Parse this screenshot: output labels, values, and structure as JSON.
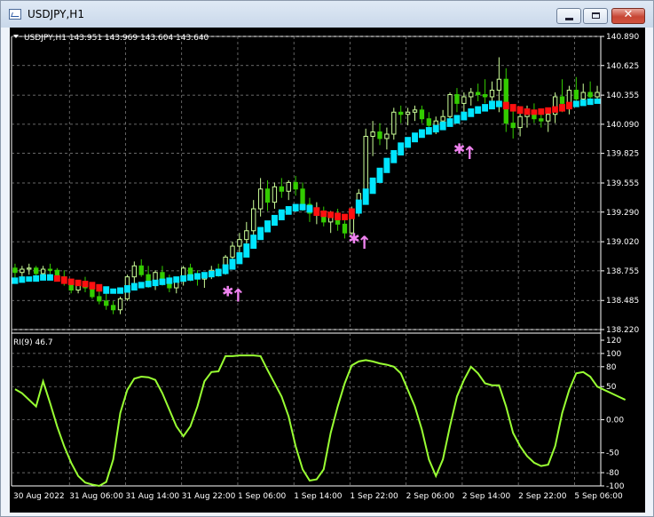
{
  "window": {
    "title": "USDJPY,H1"
  },
  "price_panel": {
    "header": "USDJPY,H1  143.951 143.969 143.604 143.640",
    "ticks": [
      "140.890",
      "140.625",
      "140.355",
      "140.090",
      "139.825",
      "139.555",
      "139.290",
      "139.020",
      "138.755",
      "138.485",
      "138.220"
    ]
  },
  "indicator_panel": {
    "header": "RI(9) 46.7",
    "ticks": [
      "120",
      "100",
      "80",
      "50",
      "0.00",
      "-50",
      "-80",
      "-100"
    ]
  },
  "time_axis": [
    "30 Aug 2022",
    "31 Aug 06:00",
    "31 Aug 14:00",
    "31 Aug 22:00",
    "1 Sep 06:00",
    "1 Sep 14:00",
    "1 Sep 22:00",
    "2 Sep 06:00",
    "2 Sep 14:00",
    "2 Sep 22:00",
    "5 Sep 06:00"
  ],
  "colors": {
    "background": "#000000",
    "grid": "#8a8a8a",
    "bull_candle": "#ccff99",
    "bear_candle": "#33cc00",
    "trend_dots_up": "#00e5ff",
    "trend_dots_down": "#ff1010",
    "arrow_signal": "#ee82ee",
    "ri_line": "#99ff33"
  },
  "chart_data": [
    {
      "type": "candlestick",
      "symbol": "USDJPY",
      "timeframe": "H1",
      "ylim": [
        138.22,
        140.89
      ],
      "candles": [
        [
          138.78,
          138.82,
          138.68,
          138.74
        ],
        [
          138.74,
          138.8,
          138.7,
          138.77
        ],
        [
          138.77,
          138.82,
          138.72,
          138.78
        ],
        [
          138.78,
          138.8,
          138.7,
          138.73
        ],
        [
          138.73,
          138.8,
          138.68,
          138.77
        ],
        [
          138.77,
          138.82,
          138.72,
          138.76
        ],
        [
          138.76,
          138.78,
          138.68,
          138.7
        ],
        [
          138.7,
          138.76,
          138.62,
          138.66
        ],
        [
          138.66,
          138.68,
          138.55,
          138.58
        ],
        [
          138.58,
          138.66,
          138.55,
          138.64
        ],
        [
          138.64,
          138.7,
          138.56,
          138.6
        ],
        [
          138.6,
          138.64,
          138.5,
          138.52
        ],
        [
          138.52,
          138.6,
          138.45,
          138.48
        ],
        [
          138.48,
          138.56,
          138.4,
          138.44
        ],
        [
          138.44,
          138.48,
          138.36,
          138.4
        ],
        [
          138.4,
          138.52,
          138.36,
          138.5
        ],
        [
          138.5,
          138.72,
          138.48,
          138.7
        ],
        [
          138.7,
          138.84,
          138.62,
          138.8
        ],
        [
          138.8,
          138.86,
          138.7,
          138.72
        ],
        [
          138.72,
          138.8,
          138.6,
          138.64
        ],
        [
          138.64,
          138.76,
          138.58,
          138.74
        ],
        [
          138.74,
          138.8,
          138.62,
          138.66
        ],
        [
          138.66,
          138.72,
          138.56,
          138.6
        ],
        [
          138.6,
          138.68,
          138.55,
          138.66
        ],
        [
          138.66,
          138.8,
          138.62,
          138.78
        ],
        [
          138.78,
          138.82,
          138.66,
          138.7
        ],
        [
          138.7,
          138.76,
          138.62,
          138.68
        ],
        [
          138.68,
          138.74,
          138.6,
          138.72
        ],
        [
          138.72,
          138.8,
          138.68,
          138.76
        ],
        [
          138.76,
          138.82,
          138.7,
          138.74
        ],
        [
          138.74,
          138.9,
          138.72,
          138.88
        ],
        [
          138.88,
          139.02,
          138.8,
          138.98
        ],
        [
          138.98,
          139.1,
          138.9,
          139.04
        ],
        [
          139.04,
          139.2,
          138.95,
          139.12
        ],
        [
          139.12,
          139.4,
          139.05,
          139.32
        ],
        [
          139.32,
          139.6,
          139.25,
          139.5
        ],
        [
          139.5,
          139.58,
          139.3,
          139.38
        ],
        [
          139.38,
          139.56,
          139.32,
          139.52
        ],
        [
          139.52,
          139.6,
          139.42,
          139.48
        ],
        [
          139.48,
          139.58,
          139.4,
          139.56
        ],
        [
          139.56,
          139.62,
          139.44,
          139.5
        ],
        [
          139.5,
          139.56,
          139.3,
          139.36
        ],
        [
          139.36,
          139.42,
          139.2,
          139.28
        ],
        [
          139.28,
          139.38,
          139.18,
          139.3
        ],
        [
          139.3,
          139.34,
          139.16,
          139.2
        ],
        [
          139.2,
          139.3,
          139.1,
          139.26
        ],
        [
          139.26,
          139.32,
          139.12,
          139.18
        ],
        [
          139.18,
          139.24,
          139.05,
          139.1
        ],
        [
          139.1,
          139.34,
          139.08,
          139.3
        ],
        [
          139.3,
          139.5,
          139.25,
          139.46
        ],
        [
          139.46,
          140.05,
          139.42,
          139.98
        ],
        [
          139.98,
          140.12,
          139.8,
          140.02
        ],
        [
          140.02,
          140.1,
          139.9,
          139.96
        ],
        [
          139.96,
          140.06,
          139.86,
          140.0
        ],
        [
          140.0,
          140.24,
          139.95,
          140.2
        ],
        [
          140.2,
          140.26,
          140.1,
          140.18
        ],
        [
          140.18,
          140.24,
          140.08,
          140.2
        ],
        [
          140.2,
          140.26,
          140.12,
          140.22
        ],
        [
          140.22,
          140.26,
          140.1,
          140.14
        ],
        [
          140.14,
          140.2,
          140.02,
          140.08
        ],
        [
          140.08,
          140.16,
          140.0,
          140.12
        ],
        [
          140.12,
          140.22,
          140.06,
          140.16
        ],
        [
          140.16,
          140.38,
          140.12,
          140.36
        ],
        [
          140.36,
          140.42,
          140.2,
          140.28
        ],
        [
          140.28,
          140.38,
          140.2,
          140.34
        ],
        [
          140.34,
          140.42,
          140.26,
          140.38
        ],
        [
          140.38,
          140.46,
          140.3,
          140.36
        ],
        [
          140.36,
          140.5,
          140.28,
          140.34
        ],
        [
          140.34,
          140.48,
          140.26,
          140.4
        ],
        [
          140.4,
          140.7,
          140.2,
          140.5
        ],
        [
          140.5,
          140.6,
          140.02,
          140.1
        ],
        [
          140.1,
          140.24,
          139.96,
          140.06
        ],
        [
          140.06,
          140.2,
          139.98,
          140.16
        ],
        [
          140.16,
          140.26,
          140.06,
          140.2
        ],
        [
          140.2,
          140.28,
          140.1,
          140.14
        ],
        [
          140.14,
          140.22,
          140.06,
          140.12
        ],
        [
          140.12,
          140.2,
          140.02,
          140.18
        ],
        [
          140.18,
          140.38,
          140.1,
          140.34
        ],
        [
          140.34,
          140.5,
          140.2,
          140.28
        ],
        [
          140.28,
          140.44,
          140.18,
          140.4
        ],
        [
          140.4,
          140.52,
          140.26,
          140.32
        ],
        [
          140.32,
          140.46,
          140.26,
          140.38
        ],
        [
          140.38,
          140.48,
          140.3,
          140.34
        ],
        [
          140.34,
          140.44,
          140.28,
          140.38
        ]
      ],
      "trend_line": [
        138.66,
        138.67,
        138.68,
        138.68,
        138.69,
        138.7,
        138.69,
        138.68,
        138.66,
        138.65,
        138.64,
        138.63,
        138.61,
        138.59,
        138.57,
        138.57,
        138.58,
        138.6,
        138.62,
        138.63,
        138.64,
        138.65,
        138.66,
        138.67,
        138.68,
        138.69,
        138.7,
        138.71,
        138.72,
        138.73,
        138.75,
        138.79,
        138.84,
        138.9,
        138.98,
        139.06,
        139.13,
        139.19,
        139.24,
        139.29,
        139.32,
        139.34,
        139.33,
        139.31,
        139.28,
        139.27,
        139.26,
        139.24,
        139.25,
        139.3,
        139.38,
        139.48,
        139.58,
        139.67,
        139.76,
        139.83,
        139.9,
        139.95,
        139.99,
        140.02,
        140.04,
        140.06,
        140.09,
        140.12,
        140.15,
        140.18,
        140.21,
        140.23,
        140.25,
        140.28,
        140.27,
        140.25,
        140.23,
        140.21,
        140.2,
        140.2,
        140.21,
        140.22,
        140.23,
        140.25,
        140.27,
        140.28,
        140.29,
        140.3
      ],
      "bear_segments": [
        [
          6,
          12
        ],
        [
          43,
          48
        ],
        [
          70,
          79
        ]
      ],
      "signals": [
        {
          "index": 31,
          "price": 138.62
        },
        {
          "index": 49,
          "price": 139.1
        },
        {
          "index": 64,
          "price": 139.92
        }
      ]
    },
    {
      "type": "line",
      "name": "RI(9)",
      "ylim": [
        -100,
        120
      ],
      "values": [
        46,
        40,
        30,
        20,
        58,
        25,
        -10,
        -40,
        -65,
        -85,
        -95,
        -98,
        -100,
        -94,
        -60,
        10,
        45,
        62,
        65,
        64,
        60,
        40,
        15,
        -10,
        -25,
        -10,
        20,
        58,
        72,
        73,
        96,
        96,
        97,
        97,
        97,
        96,
        75,
        55,
        35,
        5,
        -40,
        -75,
        -92,
        -90,
        -75,
        -20,
        20,
        55,
        82,
        88,
        90,
        88,
        85,
        83,
        80,
        70,
        45,
        20,
        -15,
        -60,
        -85,
        -60,
        -10,
        35,
        60,
        80,
        70,
        55,
        52,
        52,
        20,
        -20,
        -40,
        -55,
        -65,
        -70,
        -68,
        -40,
        10,
        45,
        70,
        72,
        65,
        50,
        45,
        40,
        35,
        30
      ]
    }
  ]
}
